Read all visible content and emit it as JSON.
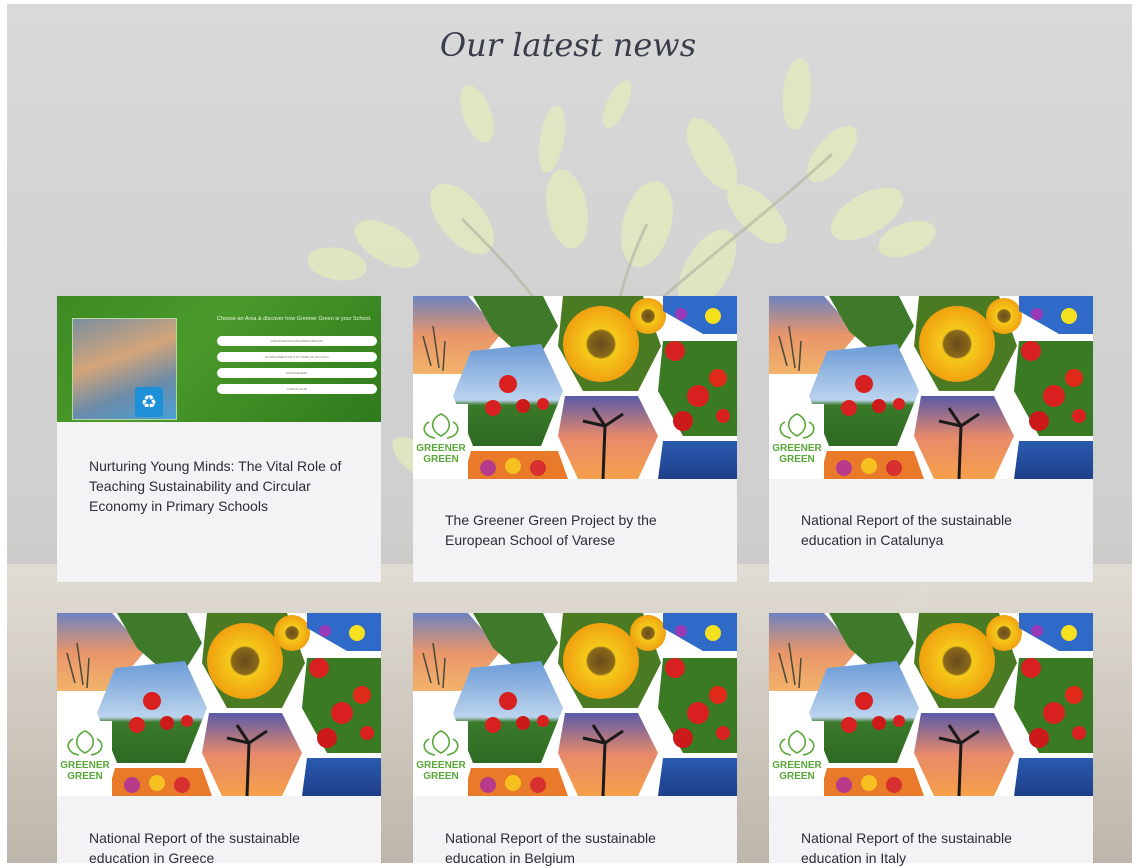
{
  "section": {
    "title": "Our latest news"
  },
  "cards": [
    {
      "title": "Nurturing Young Minds: The Vital Role of Teaching Sustainability and Circular Economy in Primary Schools",
      "image": "school-sustainability-promo",
      "promo": {
        "heading": "Choose an Area & discover how Greener Green is your School.",
        "options": [
          "ORGANIZATION AND PARTICIPATION",
          "ENVIRONMENT (IN & OUTSIDE OF SCHOOL)",
          "MANAGEMENT",
          "CURRICULUM"
        ]
      }
    },
    {
      "title": "The Greener Green Project by the European School of Varese",
      "image": "greener-green-collage"
    },
    {
      "title": "National Report of the sustainable education in Catalunya",
      "image": "greener-green-collage"
    },
    {
      "title": "National Report of the sustainable education in Greece",
      "image": "greener-green-collage"
    },
    {
      "title": "National Report of the sustainable education in Belgium",
      "image": "greener-green-collage"
    },
    {
      "title": "National Report of the sustainable education in Italy",
      "image": "greener-green-collage"
    }
  ],
  "logo": {
    "line1": "GREENER",
    "line2": "GREEN"
  },
  "colors": {
    "title": "#3a3d4a",
    "card_bg": "#f3f3f6",
    "logo_green": "#5aa83a"
  }
}
